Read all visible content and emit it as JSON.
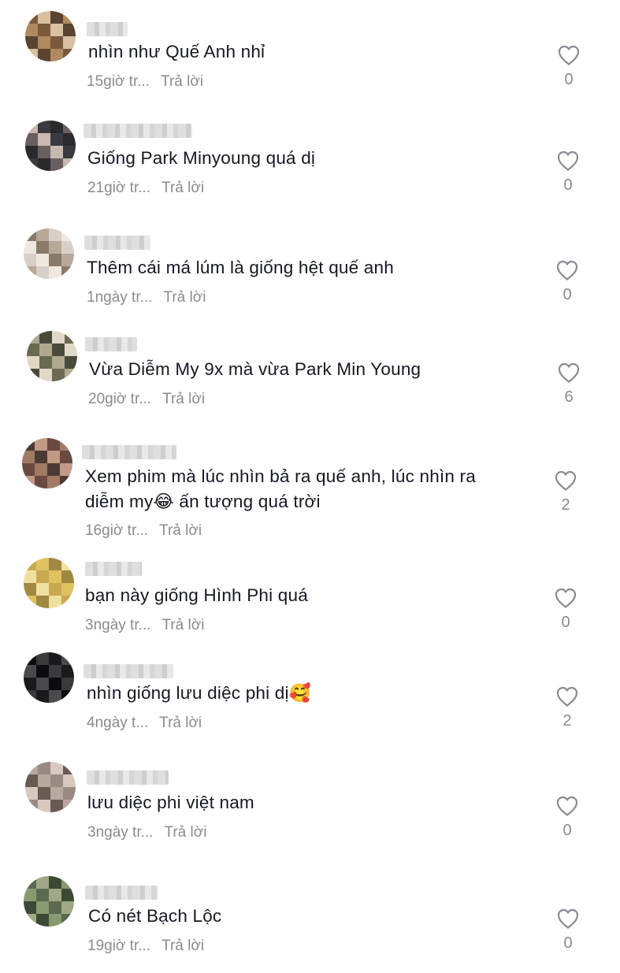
{
  "comments": [
    {
      "text": "nhìn như Quế Anh nhỉ",
      "time": "15giờ tr...",
      "reply": "Trả lời",
      "likes": "0",
      "avatar": [
        "#7a5a3c",
        "#b08a5e",
        "#5a4330",
        "#d8c0a0"
      ]
    },
    {
      "text": "Giống Park Minyoung quá dị",
      "time": "21giờ tr...",
      "reply": "Trả lời",
      "likes": "0",
      "avatar": [
        "#3a3a40",
        "#c8b8b0",
        "#6a5f60",
        "#2a2a2e"
      ]
    },
    {
      "text": "Thêm cái má lúm là giống hệt quế anh",
      "time": "1ngày tr...",
      "reply": "Trả lời",
      "likes": "0",
      "avatar": [
        "#d8cfc8",
        "#b8a898",
        "#8a7a6a",
        "#efe8e0"
      ]
    },
    {
      "text": "Vừa Diễm My 9x mà vừa Park Min Young",
      "time": "20giờ tr...",
      "reply": "Trả lời",
      "likes": "6",
      "avatar": [
        "#6a6a50",
        "#e0d8c8",
        "#4a4a3a",
        "#b0a890"
      ]
    },
    {
      "text": "Xem phim mà lúc nhìn bả ra quế anh, lúc nhìn ra\ndiễm my😂 ấn tượng quá trời",
      "time": "16giờ tr...",
      "reply": "Trả lời",
      "likes": "2",
      "avatar": [
        "#4a3a34",
        "#a07a64",
        "#6a4a40",
        "#c09a84"
      ]
    },
    {
      "text": "bạn này giống Hình Phi quá",
      "time": "3ngày tr...",
      "reply": "Trả lời",
      "likes": "0",
      "avatar": [
        "#e0c060",
        "#c8a850",
        "#f0e0a0",
        "#a08840"
      ]
    },
    {
      "text": "nhìn giống lưu diệc phi dị🥰",
      "time": "4ngày t...",
      "reply": "Trả lời",
      "likes": "2",
      "avatar": [
        "#1a1a1c",
        "#3a3a3e",
        "#0c0c0e",
        "#4a4a4e"
      ]
    },
    {
      "text": "lưu diệc phi việt nam",
      "time": "3ngày tr...",
      "reply": "Trả lời",
      "likes": "0",
      "avatar": [
        "#6a5a54",
        "#d8c8c0",
        "#9a8a84",
        "#b8a8a0"
      ]
    },
    {
      "text": "Có nét Bạch Lộc",
      "time": "19giờ tr...",
      "reply": "Trả lời",
      "likes": "0",
      "avatar": [
        "#5a6a50",
        "#8a9a70",
        "#3a4a34",
        "#a0a888"
      ]
    }
  ]
}
